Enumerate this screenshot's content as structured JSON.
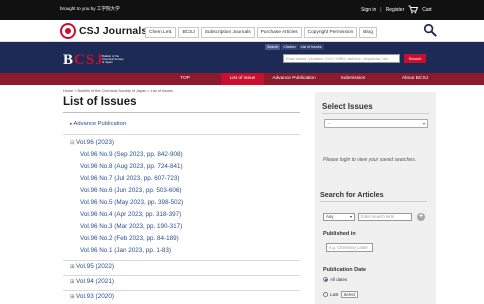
{
  "topbar": {
    "brought_by": "brought to you by 工学院大学",
    "sign_in": "Sign in",
    "sep": "|",
    "register": "Register",
    "cart": "Cart"
  },
  "header": {
    "site_title": "CSJ Journals",
    "nav": [
      "Chem.Lett.",
      "BCSJ",
      "Subscription Journals",
      "Purchase Articles",
      "Copyright Permission",
      "Blog"
    ]
  },
  "band": {
    "logo_prefix": "B",
    "logo_mid": "CSJ",
    "logo_subtitle": "Bulletin of the Chemical Society of Japan",
    "search_tabs": [
      "Search",
      "Citation",
      "List of Issues"
    ],
    "search_placeholder": "Enter words / phrases / DOI / ISBN / authors / keywords / etc.",
    "search_button": "Search"
  },
  "main_nav": {
    "items": [
      "TOP",
      "List of Issue",
      "Advance Publication",
      "Submission",
      "About BCSJ"
    ],
    "active": "List of Issue"
  },
  "breadcrumb": "Home > Bulletin of the Chemical Society of Japan > List of Issues",
  "page_title": "List of Issues",
  "advance_publication": "Advance Publication",
  "expanded_volume": {
    "label": "Vol.96 (2023)",
    "issues": [
      "Vol.96 No.9 (Sep 2023, pp. 842-908)",
      "Vol.96 No.8 (Aug 2023, pp. 724-841)",
      "Vol.96 No.7 (Jul 2023, pp. 607-723)",
      "Vol.96 No.6 (Jun 2023, pp. 503-606)",
      "Vol.96 No.5 (May 2023, pp. 398-502)",
      "Vol.96 No.4 (Apr 2023, pp. 318-397)",
      "Vol.96 No.3 (Mar 2023, pp. 190-317)",
      "Vol.96 No.2 (Feb 2023, pp. 84-189)",
      "Vol.96 No.1 (Jan 2023, pp. 1-83)"
    ]
  },
  "collapsed_volumes": [
    "Vol.95 (2022)",
    "Vol.94 (2021)",
    "Vol.93 (2020)"
  ],
  "sidebar": {
    "select_issues_title": "Select Issues",
    "select_value": "-",
    "login_note": "Please login to view your saved searches.",
    "search_articles_title": "Search for Articles",
    "any_option": "Any",
    "term_placeholder": "Enter search term",
    "published_in_label": "Published in",
    "published_in_placeholder": "e.g. Chemistry Letter",
    "publication_date_label": "Publication Date",
    "all_dates": "All dates",
    "last_label": "Last",
    "last_select": "Select"
  },
  "colors": {
    "brand_red": "#c8102e",
    "nav_dark_red": "#8b1a2c",
    "navy": "#1c2a55",
    "link_blue": "#2a4f8f"
  }
}
